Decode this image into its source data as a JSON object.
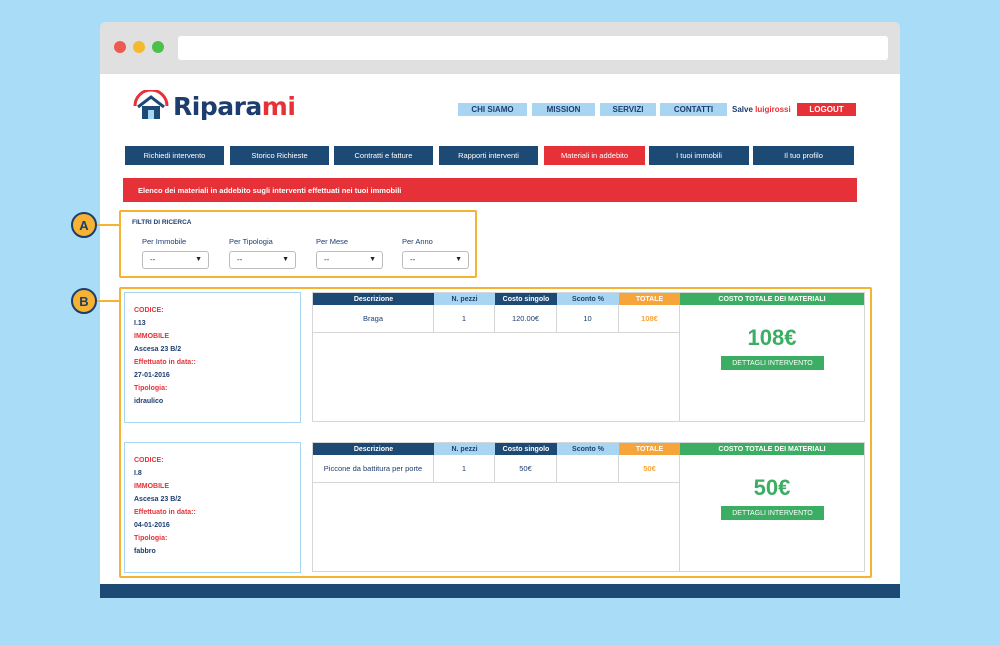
{
  "logo": {
    "text_main": "Ripara",
    "text_accent": "mi"
  },
  "topnav": [
    {
      "label": "CHI SIAMO"
    },
    {
      "label": "MISSION"
    },
    {
      "label": "SERVIZI"
    },
    {
      "label": "CONTATTI"
    }
  ],
  "user": {
    "greeting": "Salve",
    "name": "luigirossi",
    "logout_label": "LOGOUT"
  },
  "tabs": [
    {
      "label": "Richiedi intervento"
    },
    {
      "label": "Storico Richieste"
    },
    {
      "label": "Contratti e fatture"
    },
    {
      "label": "Rapporti interventi"
    },
    {
      "label": "Materiali in addebito"
    },
    {
      "label": "I tuoi immobili"
    },
    {
      "label": "Il tuo profilo"
    }
  ],
  "banner": "Elenco dei materiali in addebito sugli interventi effettuati nei tuoi immobili",
  "filters": {
    "title": "FILTRI DI RICERCA",
    "items": [
      {
        "label": "Per Immobile",
        "value": "--"
      },
      {
        "label": "Per Tipologia",
        "value": "--"
      },
      {
        "label": "Per Mese",
        "value": "--"
      },
      {
        "label": "Per Anno",
        "value": "--"
      }
    ]
  },
  "annotations": {
    "a": "A",
    "b": "B"
  },
  "labels": {
    "codice": "CODICE:",
    "immobile": "IMMOBILE",
    "data": "Effettuato in data::",
    "tipologia": "Tipologia:",
    "col_descrizione": "Descrizione",
    "col_pezzi": "N. pezzi",
    "col_costo": "Costo singolo",
    "col_sconto": "Sconto %",
    "col_totale": "TOTALE",
    "costo_totale": "COSTO TOTALE DEI MATERIALI",
    "dettagli": "DETTAGLI INTERVENTO"
  },
  "interventions": [
    {
      "codice": "I.13",
      "immobile": "Ascesa 23 B/2",
      "data": "27-01-2016",
      "tipologia": "idraulico",
      "row": {
        "descrizione": "Braga",
        "pezzi": "1",
        "costo": "120.00€",
        "sconto": "10",
        "totale": "108€"
      },
      "costo_totale": "108€"
    },
    {
      "codice": "I.8",
      "immobile": "Ascesa 23 B/2",
      "data": "04-01-2016",
      "tipologia": "fabbro",
      "row": {
        "descrizione": "Piccone da battitura per porte",
        "pezzi": "1",
        "costo": "50€",
        "sconto": "",
        "totale": "50€"
      },
      "costo_totale": "50€"
    }
  ],
  "colors": {
    "navy": "#1d4a75",
    "red": "#e63138",
    "light_blue": "#a8d6f2",
    "orange": "#f6a53b",
    "green": "#3cae63",
    "annotation": "#f6b233"
  }
}
